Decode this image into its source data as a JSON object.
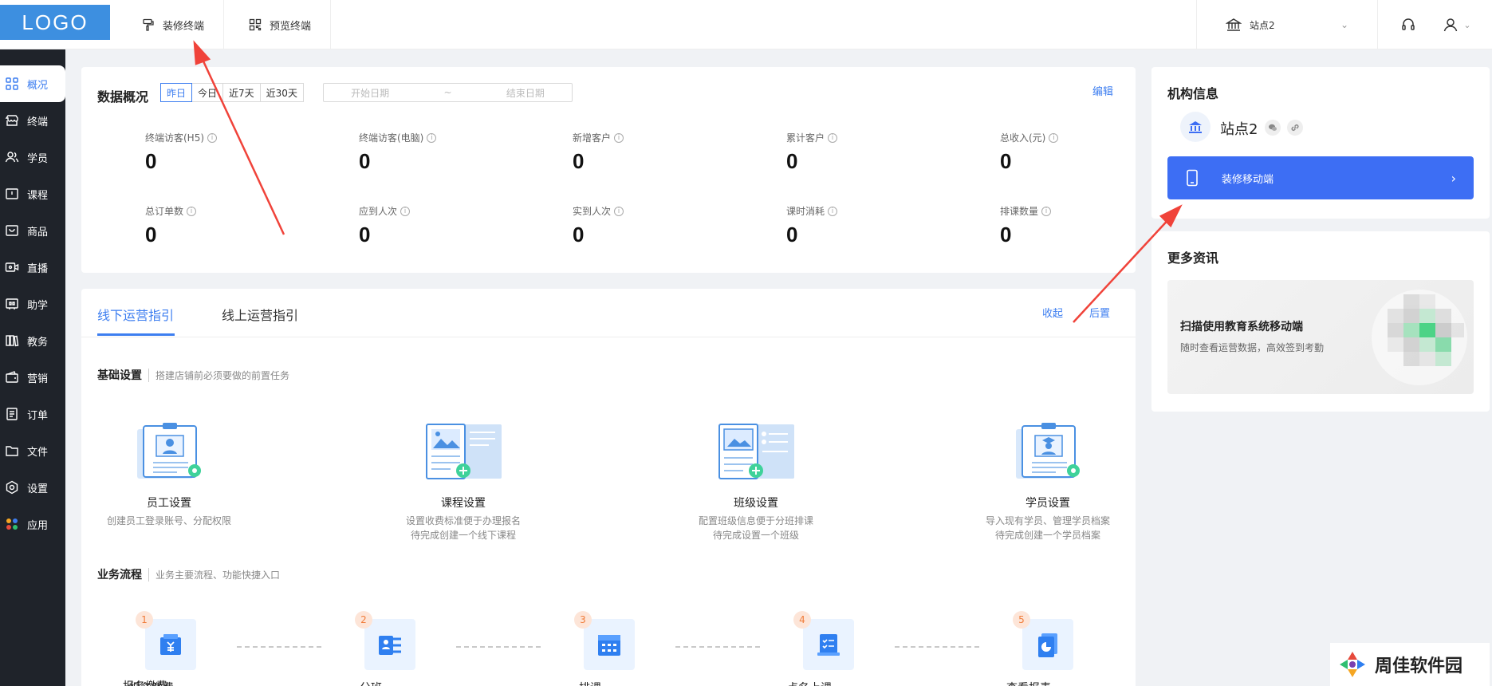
{
  "header": {
    "logo": "LOGO",
    "tabs": [
      {
        "label": "装修终端",
        "icon": "brush-icon"
      },
      {
        "label": "预览终端",
        "icon": "qrcode-icon"
      }
    ],
    "site": "站点2"
  },
  "sidebar": {
    "items": [
      {
        "label": "概况",
        "icon": "grid-icon",
        "active": true
      },
      {
        "label": "终端",
        "icon": "store-icon"
      },
      {
        "label": "学员",
        "icon": "users-icon"
      },
      {
        "label": "课程",
        "icon": "course-icon"
      },
      {
        "label": "商品",
        "icon": "goods-icon"
      },
      {
        "label": "直播",
        "icon": "live-icon"
      },
      {
        "label": "助学",
        "icon": "study-icon"
      },
      {
        "label": "教务",
        "icon": "books-icon"
      },
      {
        "label": "营销",
        "icon": "wallet-icon"
      },
      {
        "label": "订单",
        "icon": "order-icon"
      },
      {
        "label": "文件",
        "icon": "folder-icon"
      },
      {
        "label": "设置",
        "icon": "settings-icon"
      },
      {
        "label": "应用",
        "icon": "apps-icon"
      }
    ]
  },
  "overview": {
    "title": "数据概况",
    "date_tabs": [
      "昨日",
      "今日",
      "近7天",
      "近30天"
    ],
    "start_placeholder": "开始日期",
    "range_sep": "~",
    "end_placeholder": "结束日期",
    "edit": "编辑",
    "stats": [
      {
        "label": "终端访客(H5)",
        "value": "0"
      },
      {
        "label": "终端访客(电脑)",
        "value": "0"
      },
      {
        "label": "新增客户",
        "value": "0"
      },
      {
        "label": "累计客户",
        "value": "0"
      },
      {
        "label": "总收入(元)",
        "value": "0"
      },
      {
        "label": "总订单数",
        "value": "0"
      },
      {
        "label": "应到人次",
        "value": "0"
      },
      {
        "label": "实到人次",
        "value": "0"
      },
      {
        "label": "课时消耗",
        "value": "0"
      },
      {
        "label": "排课数量",
        "value": "0"
      }
    ]
  },
  "guide": {
    "tabs": [
      "线下运营指引",
      "线上运营指引"
    ],
    "collapse": "收起",
    "later": "后置",
    "basic": {
      "title": "基础设置",
      "subtitle": "搭建店铺前必须要做的前置任务",
      "items": [
        {
          "name": "员工设置",
          "desc1": "创建员工登录账号、分配权限",
          "desc2": ""
        },
        {
          "name": "课程设置",
          "desc1": "设置收费标准便于办理报名",
          "desc2": "待完成创建一个线下课程"
        },
        {
          "name": "班级设置",
          "desc1": "配置班级信息便于分班排课",
          "desc2": "待完成设置一个班级"
        },
        {
          "name": "学员设置",
          "desc1": "导入现有学员、管理学员档案",
          "desc2": "待完成创建一个学员档案"
        }
      ]
    },
    "flow": {
      "title": "业务流程",
      "subtitle": "业务主要流程、功能快捷入口",
      "steps": [
        {
          "num": "1",
          "label": "报名缴费"
        },
        {
          "num": "2",
          "label": "分班"
        },
        {
          "num": "3",
          "label": "排课"
        },
        {
          "num": "4",
          "label": "点名上课"
        },
        {
          "num": "5",
          "label": "查看报表"
        }
      ]
    }
  },
  "org": {
    "title": "机构信息",
    "name": "站点2",
    "mobile_btn": "装修移动端"
  },
  "news": {
    "title": "更多资讯",
    "promo_title": "扫描使用教育系统移动端",
    "promo_desc": "随时查看运营数据，高效签到考勤"
  },
  "watermark": "周佳软件园",
  "colors": {
    "accent": "#3d7ef0",
    "sidebar": "#1f232a",
    "arrow": "#f0433a"
  }
}
